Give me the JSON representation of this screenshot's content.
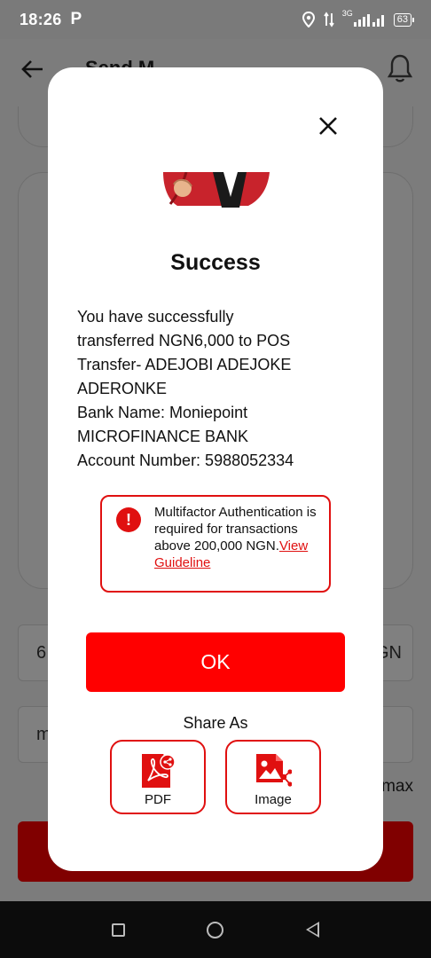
{
  "status_bar": {
    "time": "18:26",
    "app_icon": "P",
    "network": "3G",
    "battery": "63"
  },
  "background": {
    "title": "Send M",
    "amount_value": "6",
    "amount_currency": "GN",
    "note_value": "m",
    "max_label": "max"
  },
  "dialog": {
    "title": "Success",
    "message_lines": [
      "You have successfully",
      "transferred NGN6,000 to POS",
      "Transfer- ADEJOBI ADEJOKE",
      "ADERONKE",
      "Bank Name: Moniepoint",
      "MICROFINANCE BANK",
      "Account Number: 5988052334"
    ],
    "mfa_notice": {
      "text": "Multifactor Authentication is required for transactions above 200,000 NGN.",
      "link": "View Guideline"
    },
    "ok_label": "OK",
    "share_label": "Share As",
    "share_options": [
      {
        "label": "PDF",
        "icon": "pdf-share-icon"
      },
      {
        "label": "Image",
        "icon": "image-share-icon"
      }
    ]
  },
  "colors": {
    "accent": "#ff0000",
    "border_red": "#e01010",
    "overlay": "#7c7c7c"
  }
}
